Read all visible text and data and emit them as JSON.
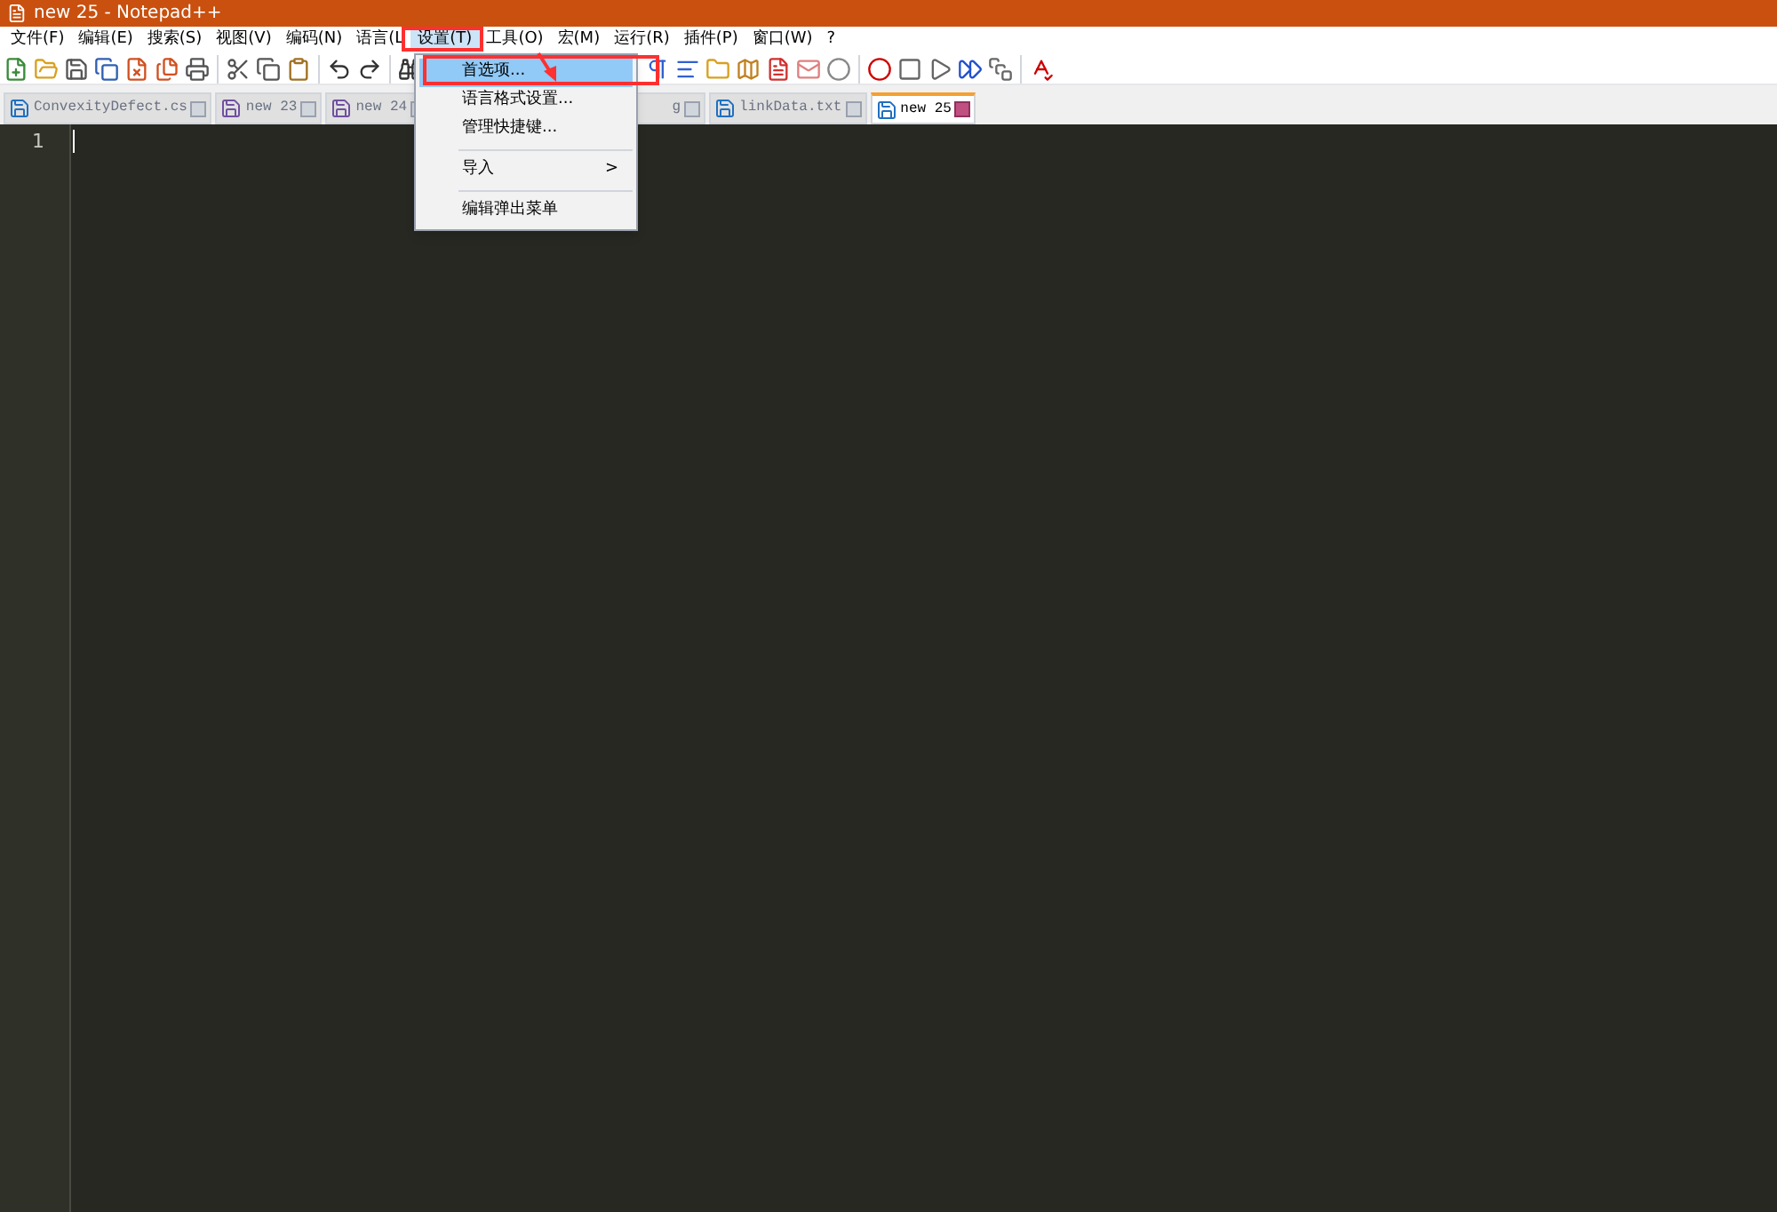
{
  "window": {
    "title": "new 25 - Notepad++"
  },
  "menu_bar": [
    {
      "label": "文件(F)",
      "selected": false
    },
    {
      "label": "编辑(E)",
      "selected": false
    },
    {
      "label": "搜索(S)",
      "selected": false
    },
    {
      "label": "视图(V)",
      "selected": false
    },
    {
      "label": "编码(N)",
      "selected": false
    },
    {
      "label": "语言(L",
      "selected": false
    },
    {
      "label": "设置(T)",
      "selected": true
    },
    {
      "label": "工具(O)",
      "selected": false
    },
    {
      "label": "宏(M)",
      "selected": false
    },
    {
      "label": "运行(R)",
      "selected": false
    },
    {
      "label": "插件(P)",
      "selected": false
    },
    {
      "label": "窗口(W)",
      "selected": false
    },
    {
      "label": "?",
      "selected": false
    }
  ],
  "tabs": [
    {
      "label": "ConvexityDefect.cs",
      "selected": false,
      "saved": true
    },
    {
      "label": "new 23",
      "selected": false,
      "saved": false
    },
    {
      "label": "new 24",
      "selected": false,
      "saved": false
    },
    {
      "label": "g",
      "selected": false
    },
    {
      "label": "linkData.txt",
      "selected": false,
      "saved": true
    },
    {
      "label": "new 25",
      "selected": true,
      "saved": true
    }
  ],
  "dropdown": [
    {
      "kind": "item",
      "label": "首选项...",
      "selected": true
    },
    {
      "kind": "item",
      "label": "语言格式设置...",
      "selected": false
    },
    {
      "kind": "item",
      "label": "管理快捷键...",
      "selected": false
    },
    {
      "kind": "separator"
    },
    {
      "kind": "submenu",
      "label": "导入",
      "arrow": ">",
      "selected": false
    },
    {
      "kind": "separator"
    },
    {
      "kind": "item",
      "label": "编辑弹出菜单",
      "selected": false
    }
  ],
  "editor": {
    "line_numbers": [
      "1"
    ]
  }
}
